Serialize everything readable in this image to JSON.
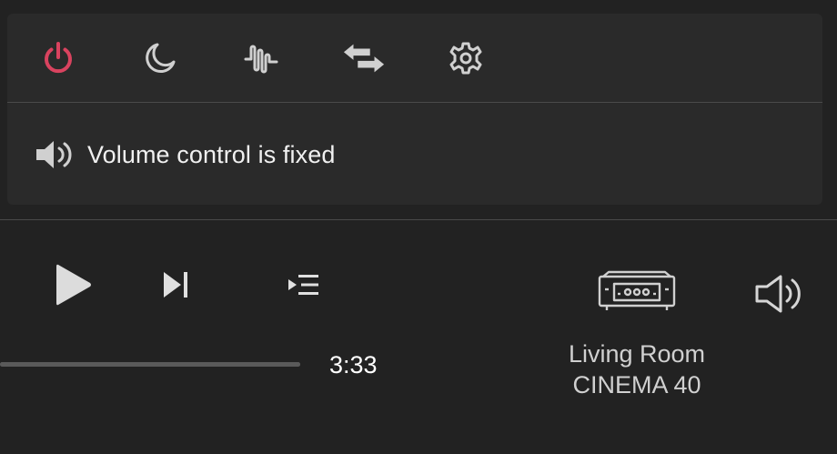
{
  "icon_bar": {
    "items": [
      {
        "name": "power-icon",
        "color": "#d9435f"
      },
      {
        "name": "sleep-moon-icon",
        "color": "#d0d0d0"
      },
      {
        "name": "audio-wave-icon",
        "color": "#d0d0d0"
      },
      {
        "name": "swap-arrows-icon",
        "color": "#d0d0d0"
      },
      {
        "name": "gear-icon",
        "color": "#d0d0d0"
      }
    ]
  },
  "volume_note": {
    "icon": "speaker-icon",
    "text": "Volume control is fixed"
  },
  "player": {
    "play_icon": "play-icon",
    "next_icon": "skip-next-icon",
    "queue_icon": "queue-list-icon",
    "progress": 1.0,
    "time": "3:33"
  },
  "zone": {
    "device_icon": "receiver-icon",
    "room": "Living Room",
    "device": "CINEMA 40",
    "volume_icon": "volume-icon"
  },
  "colors": {
    "background": "#222222",
    "panel": "#2a2a2a",
    "accent_power": "#d9435f",
    "icon": "#d0d0d0"
  }
}
